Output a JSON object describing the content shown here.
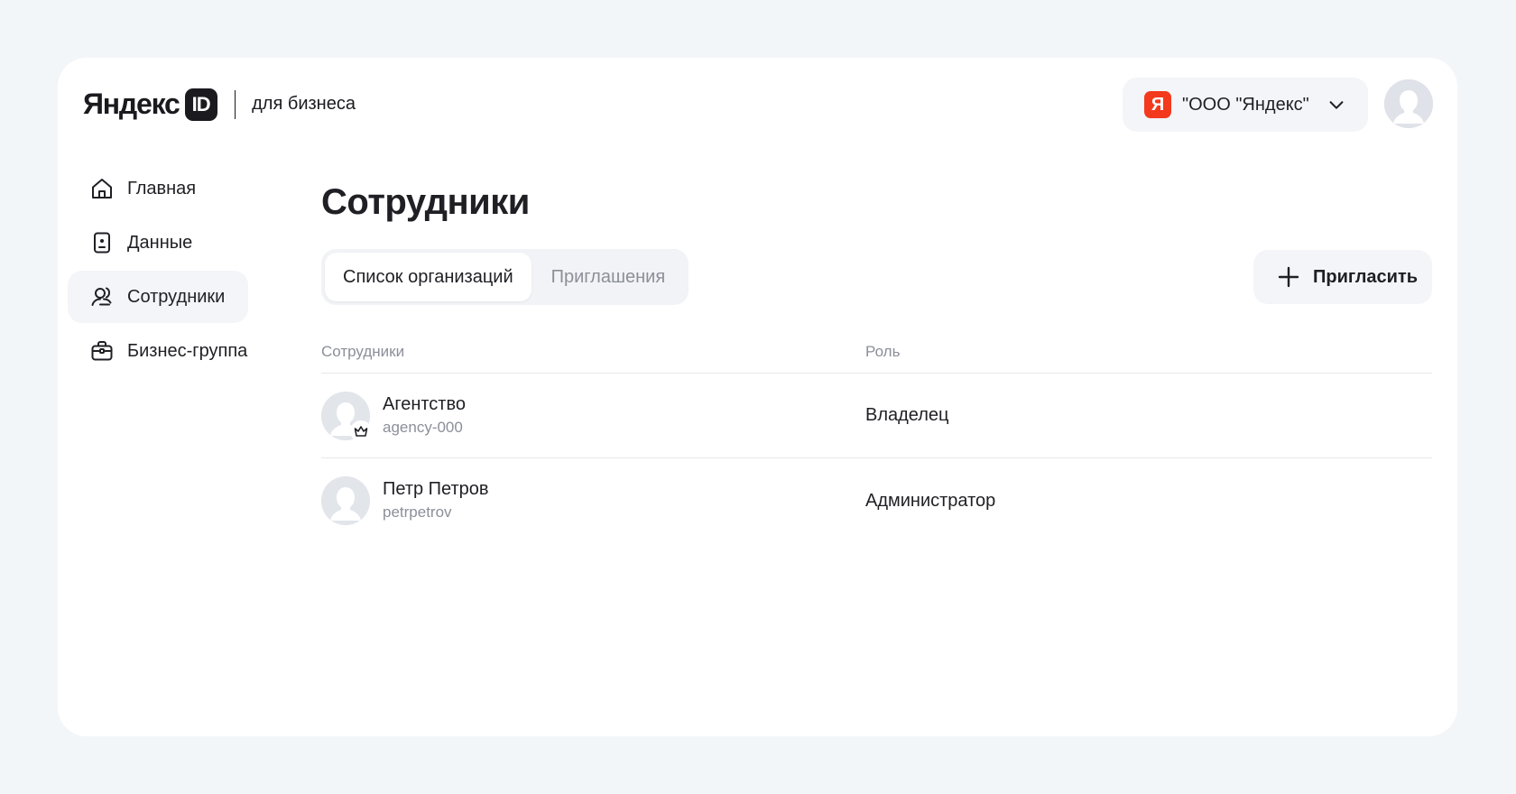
{
  "header": {
    "logo_word": "Яндекс",
    "logo_id": "ID",
    "logo_sub": "для бизнеса",
    "org_mark": "Я",
    "org_name": "\"ООО \"Яндекс\"",
    "brand_color": "#f33a1d"
  },
  "sidebar": {
    "items": [
      {
        "label": "Главная",
        "icon": "home-icon",
        "active": false
      },
      {
        "label": "Данные",
        "icon": "id-card-icon",
        "active": false
      },
      {
        "label": "Сотрудники",
        "icon": "users-icon",
        "active": true
      },
      {
        "label": "Бизнес-группа",
        "icon": "briefcase-icon",
        "active": false
      }
    ]
  },
  "main": {
    "title": "Сотрудники",
    "tabs": [
      {
        "label": "Список организаций",
        "active": true
      },
      {
        "label": "Приглашения",
        "active": false
      }
    ],
    "invite_label": "Пригласить",
    "table": {
      "headers": [
        "Сотрудники",
        "Роль"
      ],
      "rows": [
        {
          "name": "Агентство",
          "login": "agency-000",
          "role": "Владелец",
          "owner": true
        },
        {
          "name": "Петр Петров",
          "login": "petrpetrov",
          "role": "Администратор",
          "owner": false
        }
      ]
    }
  }
}
